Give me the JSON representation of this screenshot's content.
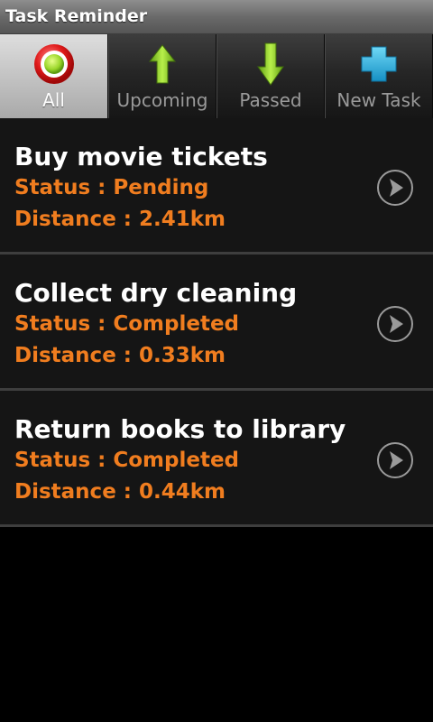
{
  "app": {
    "title": "Task Reminder"
  },
  "tabs": [
    {
      "label": "All",
      "icon": "record-circle-icon",
      "selected": true
    },
    {
      "label": "Upcoming",
      "icon": "arrow-up-icon",
      "selected": false
    },
    {
      "label": "Passed",
      "icon": "arrow-down-icon",
      "selected": false
    },
    {
      "label": "New Task",
      "icon": "plus-cross-icon",
      "selected": false
    }
  ],
  "tasks": [
    {
      "name": "Buy movie tickets",
      "status": "Status : Pending",
      "distance": "Distance : 2.41km"
    },
    {
      "name": "Collect dry cleaning",
      "status": "Status : Completed",
      "distance": "Distance : 0.33km"
    },
    {
      "name": "Return books to library",
      "status": "Status : Completed",
      "distance": "Distance : 0.44km"
    }
  ],
  "colors": {
    "accent_orange": "#f07d1f",
    "icon_green": "#8bd12c",
    "icon_blue": "#1fa8d6",
    "icon_red": "#e02020"
  }
}
